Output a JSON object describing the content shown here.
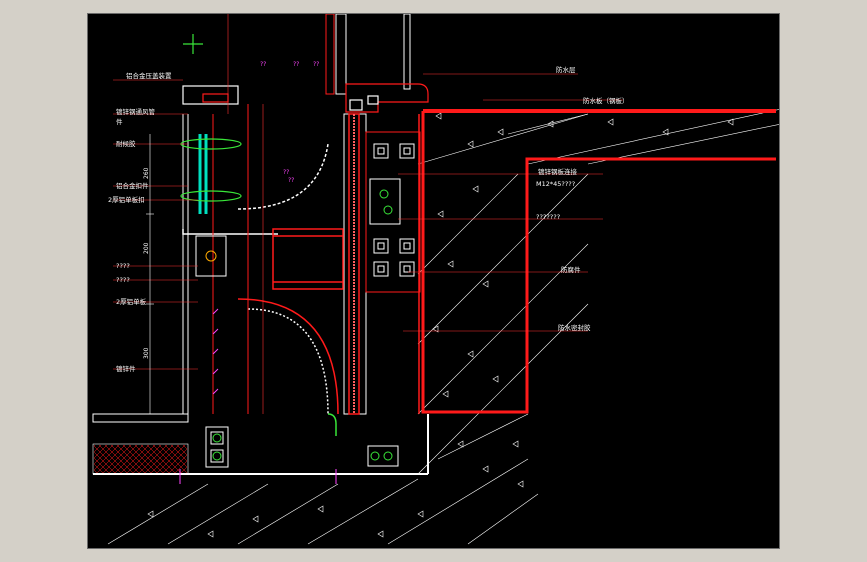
{
  "colors": {
    "background": "#000000",
    "frame": "#d4d0c8",
    "wall": "#ff1a1a",
    "glass": "#00e0c0",
    "leader": "#ff3030",
    "text": "#ffffff",
    "magenta": "#ff44ff",
    "green": "#39e639"
  },
  "labels": {
    "left_1": "铝合金压盖装置",
    "left_2": "镀锌钢通风管",
    "left_2b": "件",
    "left_3": "耐候胶",
    "left_4": "铝合金扣件",
    "left_5": "2厚铝单板扣",
    "left_6": "????",
    "left_7": "????",
    "left_8": "2厚铝单板",
    "left_9": "镀锌件",
    "right_1": "防水层",
    "right_2": "防水板（钢板）",
    "right_3": "镀锌钢板连接",
    "right_3b": "M12*45????",
    "right_4": "???????",
    "right_5": "防腐件",
    "right_6": "防水密封胶",
    "magenta_1": "??",
    "magenta_2": "??",
    "magenta_3": "??",
    "magenta_4": "??",
    "magenta_5": "??",
    "dim_1": "260",
    "dim_2": "200",
    "dim_3": "300"
  }
}
